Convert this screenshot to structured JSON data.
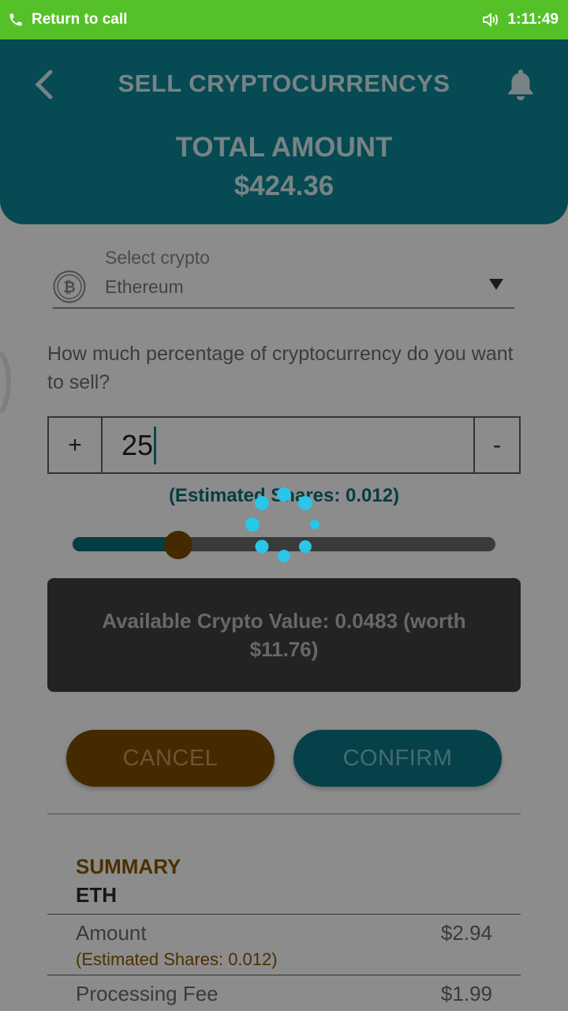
{
  "status_bar": {
    "call_text": "Return to call",
    "time": "1:11:49",
    "background": "#55c129"
  },
  "header": {
    "title": "SELL CRYPTOCURRENCYS",
    "total_label": "TOTAL AMOUNT",
    "total_value": "$424.36",
    "background": "#0c8797"
  },
  "select": {
    "label": "Select crypto",
    "value": "Ethereum",
    "icon": "bitcoin-icon"
  },
  "question": "How much percentage of cryptocurrency do you want to sell?",
  "stepper": {
    "plus_label": "+",
    "minus_label": "-",
    "value": "25"
  },
  "estimated_shares": "(Estimated Shares: 0.012)",
  "slider": {
    "percent": 25
  },
  "available": "Available Crypto Value: 0.0483 (worth $11.76)",
  "buttons": {
    "cancel": "CANCEL",
    "confirm": "CONFIRM"
  },
  "summary": {
    "title": "SUMMARY",
    "asset": "ETH",
    "rows": [
      {
        "label": "Amount",
        "value": "$2.94",
        "note": "(Estimated Shares: 0.012)"
      },
      {
        "label": "Processing Fee",
        "value": "$1.99"
      }
    ]
  },
  "colors": {
    "accent": "#0c8797",
    "cancel": "#7e4e00",
    "spinner": "#29c6e8"
  },
  "loading": true
}
